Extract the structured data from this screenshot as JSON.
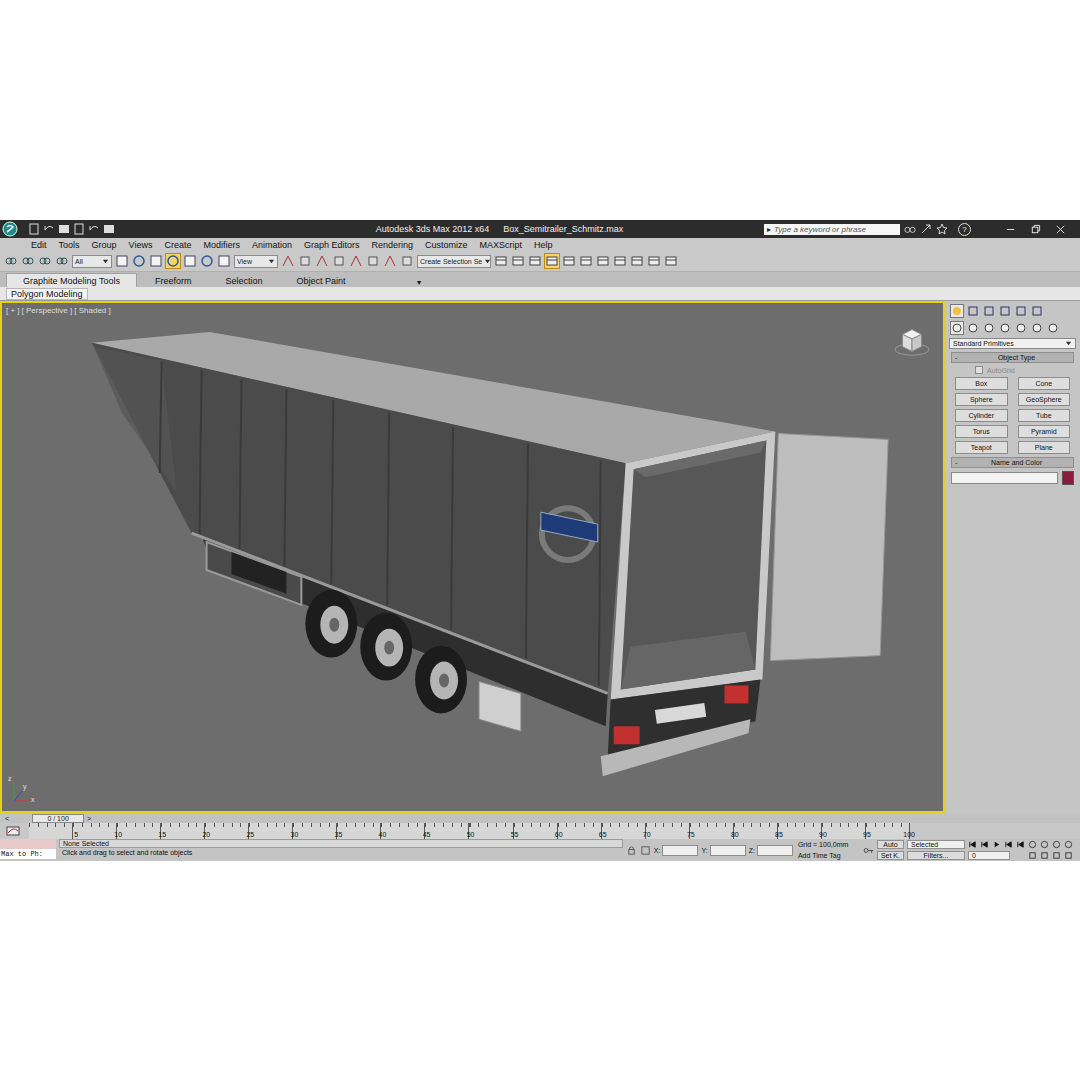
{
  "window": {
    "title": "Autodesk 3ds Max  2012 x64",
    "file": "Box_Semitrailer_Schmitz.max"
  },
  "search": {
    "arrow": "▸",
    "placeholder": "Type a keyword or phrase"
  },
  "help": "?",
  "menu": [
    "Edit",
    "Tools",
    "Group",
    "Views",
    "Create",
    "Modifiers",
    "Animation",
    "Graph Editors",
    "Rendering",
    "Customize",
    "MAXScript",
    "Help"
  ],
  "toolbar": {
    "filter": "All",
    "reference": "View",
    "selection_set": "Create Selection Se"
  },
  "ribbon": {
    "tabs": [
      {
        "label": "Graphite Modeling Tools",
        "selected": true
      },
      {
        "label": "Freeform",
        "selected": false
      },
      {
        "label": "Selection",
        "selected": false
      },
      {
        "label": "Object Paint",
        "selected": false
      }
    ],
    "menu_arrow": "▾",
    "panel": "Polygon Modeling"
  },
  "viewport": {
    "labels": [
      "[ + ]",
      "[ Perspective ]",
      "[ Shaded ]"
    ],
    "active": true,
    "axes": [
      "x",
      "y",
      "z"
    ]
  },
  "command_panel": {
    "category": "Standard Primitives",
    "object_type": {
      "toggle": "-",
      "title": "Object Type",
      "autogrid": {
        "label": "AutoGrid",
        "checked": false,
        "disabled": true
      },
      "buttons": [
        "Box",
        "Cone",
        "Sphere",
        "GeoSphere",
        "Cylinder",
        "Tube",
        "Torus",
        "Pyramid",
        "Teapot",
        "Plane"
      ]
    },
    "name_and_color": {
      "toggle": "-",
      "title": "Name and Color",
      "name": "",
      "color": "#8e1b3e"
    }
  },
  "time_slider": {
    "prev": "<",
    "position": "0 / 100",
    "next": ">"
  },
  "trackbar": {
    "ticks": [
      "5",
      "10",
      "15",
      "20",
      "25",
      "30",
      "35",
      "40",
      "45",
      "50",
      "55",
      "60",
      "65",
      "70",
      "75",
      "80",
      "85",
      "90",
      "95",
      "100"
    ]
  },
  "status": {
    "listener": "Max to Ph:",
    "selection": "None Selected",
    "prompt": "Click and drag to select and rotate objects",
    "coords": [
      {
        "label": "X:",
        "value": ""
      },
      {
        "label": "Y:",
        "value": ""
      },
      {
        "label": "Z:",
        "value": ""
      }
    ],
    "grid": "Grid = 100,0mm",
    "add_time_tag": "Add Time Tag",
    "auto_key": "Auto",
    "set_key": "Set K.",
    "key_filter": "Selected",
    "filters": "Filters...",
    "frame": "0"
  }
}
